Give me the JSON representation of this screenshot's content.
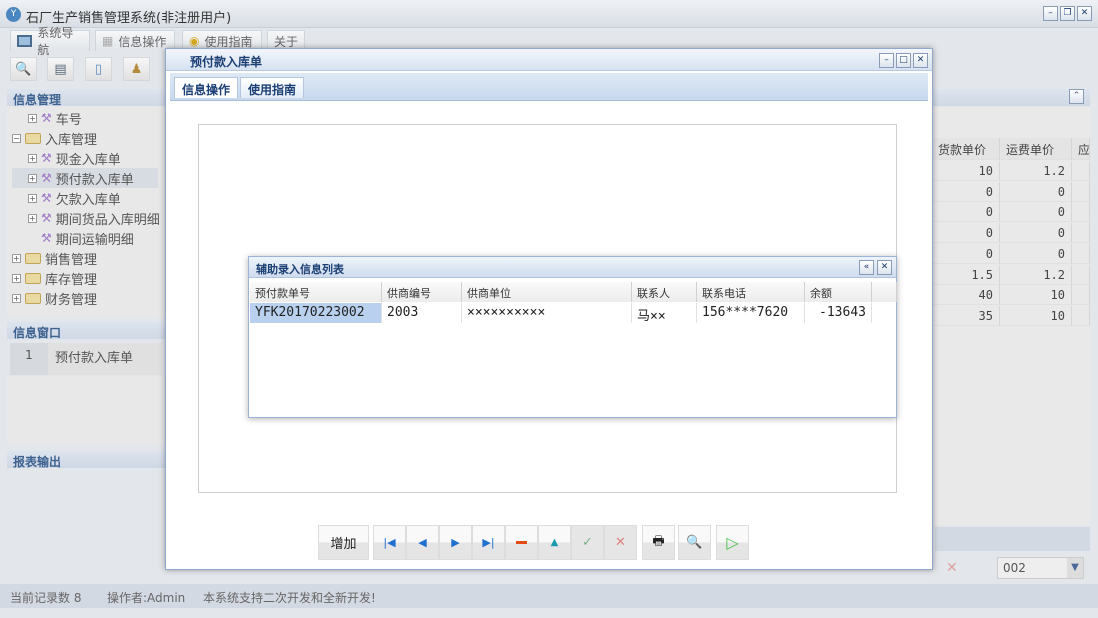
{
  "app": {
    "title": "石厂生产销售管理系统(非注册用户)"
  },
  "main_tabs": [
    {
      "label": "系统导航"
    },
    {
      "label": "信息操作"
    },
    {
      "label": "使用指南"
    },
    {
      "label": "关于"
    }
  ],
  "left": {
    "info_mgmt_header": "信息管理",
    "tree": [
      {
        "label": "车号",
        "level": 1
      },
      {
        "label": "入库管理",
        "level": 0
      },
      {
        "label": "现金入库单",
        "level": 1
      },
      {
        "label": "预付款入库单",
        "level": 1,
        "selected": true
      },
      {
        "label": "欠款入库单",
        "level": 1
      },
      {
        "label": "期间货品入库明细",
        "level": 1
      },
      {
        "label": "期间运输明细",
        "level": 1
      },
      {
        "label": "销售管理",
        "level": 0
      },
      {
        "label": "库存管理",
        "level": 0
      },
      {
        "label": "财务管理",
        "level": 0
      }
    ],
    "info_window_header": "信息窗口",
    "info_window_rows": [
      {
        "num": "1",
        "label": "预付款入库单"
      }
    ],
    "report_header": "报表输出"
  },
  "grid": {
    "columns": [
      "货款单价",
      "运费单价",
      "应"
    ],
    "rows": [
      [
        "10",
        "1.2"
      ],
      [
        "0",
        "0"
      ],
      [
        "0",
        "0"
      ],
      [
        "0",
        "0"
      ],
      [
        "0",
        "0"
      ],
      [
        "1.5",
        "1.2"
      ],
      [
        "40",
        "10"
      ],
      [
        "35",
        "10"
      ]
    ]
  },
  "bottom": {
    "combo_value": "002"
  },
  "status": {
    "records": "当前记录数 8",
    "operator": "操作者:Admin",
    "message": "本系统支持二次开发和全新开发!"
  },
  "dialog": {
    "title": "预付款入库单",
    "tabs": [
      {
        "label": "信息操作"
      },
      {
        "label": "使用指南"
      }
    ],
    "add_button": "增加"
  },
  "sub_dialog": {
    "title": "辅助录入信息列表",
    "columns": [
      "预付款单号",
      "供商编号",
      "供商单位",
      "联系人",
      "联系电话",
      "余额"
    ],
    "rows": [
      [
        "YFK20170223002",
        "2003",
        "××××××××××",
        "马××",
        "156****7620",
        "-13643"
      ]
    ]
  }
}
